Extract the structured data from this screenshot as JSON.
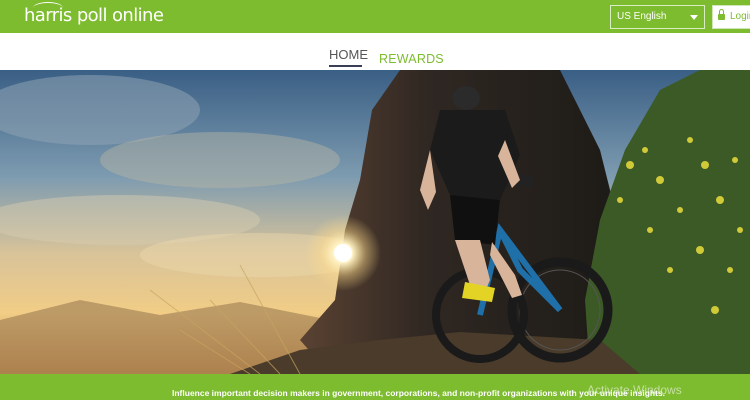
{
  "header": {
    "logo_text": "harris poll online",
    "language": "US English",
    "login_label": "Login"
  },
  "nav": {
    "tabs": [
      "HOME",
      "REWARDS"
    ]
  },
  "footer": {
    "tagline": "Influence important decision makers in government, corporations, and non-profit organizations with your unique insights.",
    "watermark": "Activate Windows"
  },
  "colors": {
    "brand_green": "#7dbb2f",
    "nav_underline": "#3a3f56"
  },
  "icons": {
    "login": "lock-icon",
    "language": "chevron-down-icon"
  }
}
